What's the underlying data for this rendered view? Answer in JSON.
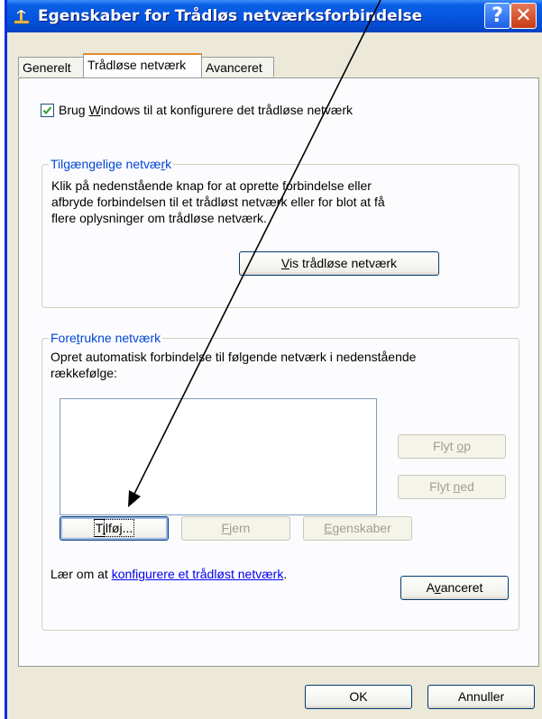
{
  "window": {
    "title": "Egenskaber for Trådløs netværksforbindelse",
    "help_glyph": "?",
    "close_glyph": "✕"
  },
  "tabs": [
    {
      "label": "Generelt"
    },
    {
      "label": "Trådløse netværk",
      "active": true
    },
    {
      "label": "Avanceret"
    }
  ],
  "wireless": {
    "use_windows": {
      "pre": "Brug ",
      "accel": "W",
      "post": "indows til at konfigurere det trådløse netværk",
      "checked": true
    },
    "available": {
      "title_pre": "Tilgængelige netvæ",
      "title_accel": "r",
      "title_post": "k",
      "description": [
        "Klik på nedenstående knap for at oprette forbindelse eller",
        "afbryde forbindelsen til et trådløst netværk eller for blot at få",
        "flere oplysninger om trådløse netværk."
      ],
      "view_btn_pre": "",
      "view_btn_accel": "V",
      "view_btn_post": "is trådløse netværk"
    },
    "preferred": {
      "title_pre": "Fore",
      "title_accel": "t",
      "title_post": "rukne netværk",
      "description": [
        "Opret automatisk forbindelse til følgende netværk i nedenstående",
        "rækkefølge:"
      ],
      "move_up": {
        "pre": "Flyt ",
        "accel": "o",
        "post": "p"
      },
      "move_down": {
        "pre": "Flyt ",
        "accel": "n",
        "post": "ed"
      },
      "add": {
        "pre": "T",
        "accel": "i",
        "post": "lføj..."
      },
      "remove": {
        "pre": "",
        "accel": "F",
        "post": "jern"
      },
      "properties": {
        "pre": "",
        "accel": "E",
        "post": "genskaber"
      },
      "learn_pre": "Lær om at ",
      "learn_link": "konfigurere et trådløst netværk",
      "learn_post": ".",
      "advanced": {
        "pre": "A",
        "accel": "v",
        "post": "anceret"
      }
    }
  },
  "footer": {
    "ok": "OK",
    "cancel": "Annuller"
  },
  "colors": {
    "titlebar": "#0553dc",
    "group_title": "#0046d5",
    "dialog_bg": "#ece9d8",
    "arrow": "#000000"
  }
}
